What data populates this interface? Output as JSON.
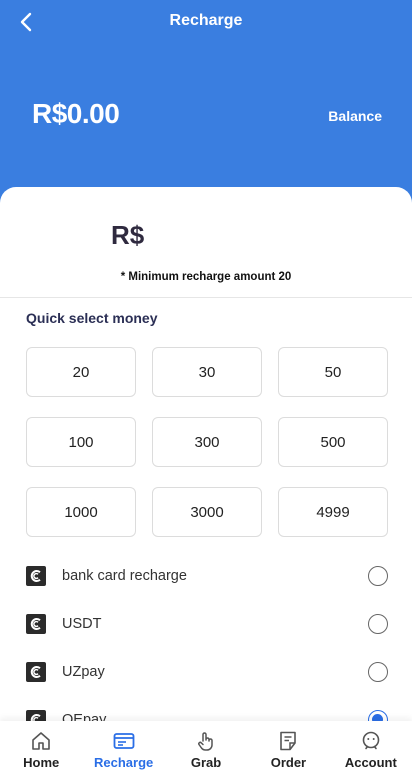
{
  "header": {
    "title": "Recharge",
    "balance_amount": "R$0.00",
    "balance_label": "Balance"
  },
  "form": {
    "currency_symbol": "R$",
    "min_note": "* Minimum recharge amount 20",
    "quick_title": "Quick select money",
    "amounts": [
      "20",
      "30",
      "50",
      "100",
      "300",
      "500",
      "1000",
      "3000",
      "4999"
    ]
  },
  "payment_methods": [
    {
      "label": "bank card recharge",
      "selected": false
    },
    {
      "label": "USDT",
      "selected": false
    },
    {
      "label": "UZpay",
      "selected": false
    },
    {
      "label": "OEpay",
      "selected": true
    }
  ],
  "tabbar": {
    "items": [
      {
        "label": "Home",
        "icon": "home-icon",
        "active": false
      },
      {
        "label": "Recharge",
        "icon": "wallet-icon",
        "active": true
      },
      {
        "label": "Grab",
        "icon": "hand-tap-icon",
        "active": false
      },
      {
        "label": "Order",
        "icon": "order-icon",
        "active": false
      },
      {
        "label": "Account",
        "icon": "account-icon",
        "active": false
      }
    ]
  },
  "colors": {
    "header_bg": "#3a7ee0",
    "accent": "#2a6ee6",
    "quick_title": "#2b2f55"
  }
}
